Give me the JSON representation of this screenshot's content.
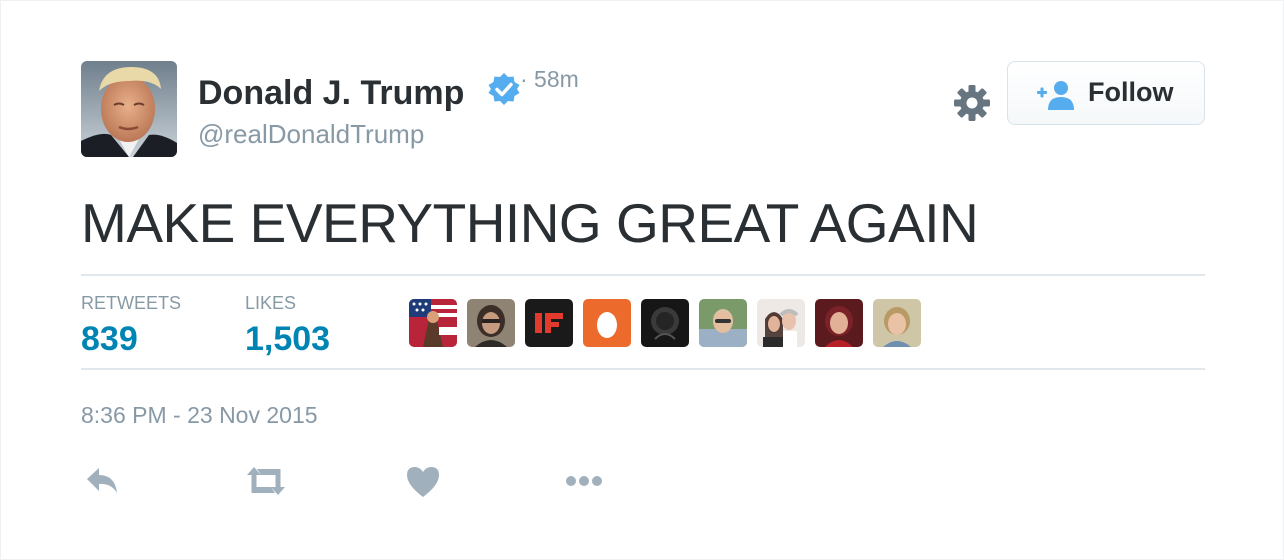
{
  "user": {
    "name": "Donald J. Trump",
    "handle": "@realDonaldTrump",
    "verified": true,
    "time_ago": "· 58m"
  },
  "follow_button": {
    "label": "Follow",
    "icon": "add-user-icon"
  },
  "settings_icon": "gear-icon",
  "tweet": {
    "text": "MAKE EVERYTHING GREAT AGAIN",
    "timestamp": "8:36 PM - 23 Nov 2015"
  },
  "stats": {
    "retweets_label": "RETWEETS",
    "retweets_value": "839",
    "likes_label": "LIKES",
    "likes_value": "1,503"
  },
  "favoriters": [
    {
      "kind": "flag-collage"
    },
    {
      "kind": "photo-portrait"
    },
    {
      "kind": "logo-if"
    },
    {
      "kind": "egg-default"
    },
    {
      "kind": "dark-photo"
    },
    {
      "kind": "photo-portrait"
    },
    {
      "kind": "photo-couple"
    },
    {
      "kind": "photo-portrait"
    },
    {
      "kind": "photo-portrait"
    }
  ],
  "actions": [
    {
      "name": "reply",
      "icon": "reply-icon"
    },
    {
      "name": "retweet",
      "icon": "retweet-icon"
    },
    {
      "name": "like",
      "icon": "heart-icon"
    },
    {
      "name": "more",
      "icon": "more-icon"
    }
  ],
  "colors": {
    "text": "#292f33",
    "muted": "#8899a6",
    "link": "#0084b4",
    "verified": "#55acee",
    "icon": "#a0b1bd",
    "divider": "#e1e8ed"
  }
}
